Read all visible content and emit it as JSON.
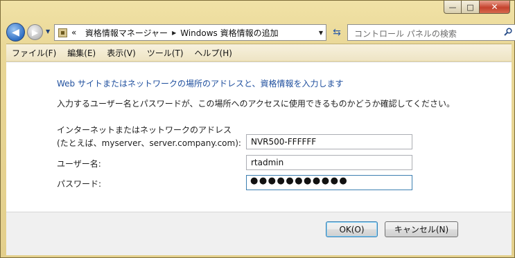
{
  "titlebar": {
    "minimize_glyph": "—",
    "maximize_glyph": "□",
    "close_glyph": "✕"
  },
  "nav": {
    "back_glyph": "◀",
    "forward_glyph": "▶",
    "breadcrumb_prefix": "«",
    "breadcrumb": [
      "資格情報マネージャー",
      "Windows 資格情報の追加"
    ],
    "search_placeholder": "コントロール パネルの検索"
  },
  "menu": {
    "items": [
      "ファイル(F)",
      "編集(E)",
      "表示(V)",
      "ツール(T)",
      "ヘルプ(H)"
    ]
  },
  "form": {
    "heading": "Web サイトまたはネットワークの場所のアドレスと、資格情報を入力します",
    "description": "入力するユーザー名とパスワードが、この場所へのアクセスに使用できるものかどうか確認してください。",
    "address_label_line1": "インターネットまたはネットワークのアドレス",
    "address_label_line2": "(たとえば、myserver、server.company.com):",
    "address_value": "NVR500-FFFFFF",
    "username_label": "ユーザー名:",
    "username_value": "rtadmin",
    "password_label": "パスワード:",
    "password_masked": "●●●●●●●●●●●"
  },
  "buttons": {
    "ok": "OK(O)",
    "cancel": "キャンセル(N)"
  },
  "colors": {
    "accent_heading": "#1f4f9e",
    "window_frame": "#e3cf8c"
  }
}
